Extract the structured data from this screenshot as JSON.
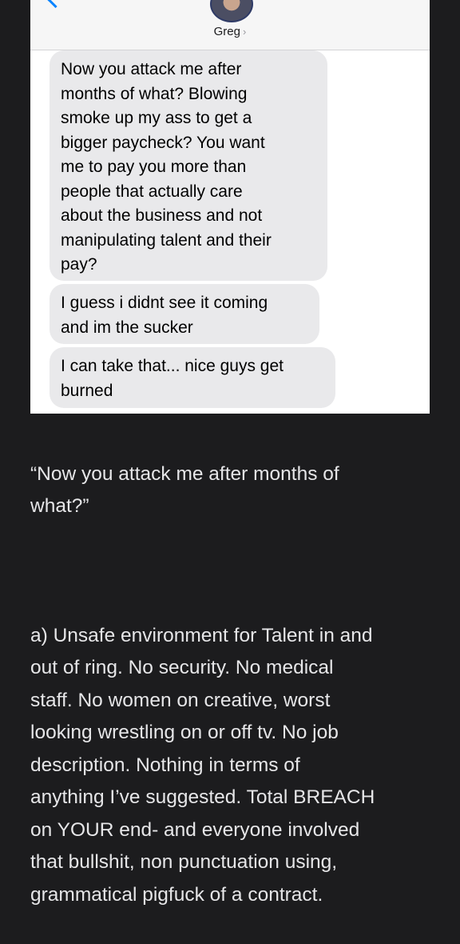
{
  "header": {
    "contact_name": "Greg",
    "chevron": "›"
  },
  "messages": [
    "Now you attack me after\nmonths of what? Blowing\nsmoke up my ass to get a\nbigger paycheck? You want\nme to pay you more than\npeople that actually care\nabout the business and not\nmanipulating talent and their\npay?",
    "I guess i didnt see it coming\nand im the sucker",
    "I can take that... nice guys get\nburned"
  ],
  "caption": {
    "quote": "“Now you attack me after months of\nwhat?”",
    "body": "a) Unsafe environment for Talent in and\nout of ring. No security. No medical\nstaff. No women on creative, worst\nlooking wrestling on or off tv. No job\ndescription. Nothing in terms of\nanything I’ve suggested. Total BREACH\non YOUR end-  and everyone involved\nthat bullshit, non punctuation using,\ngrammatical pigfuck of a contract."
  }
}
